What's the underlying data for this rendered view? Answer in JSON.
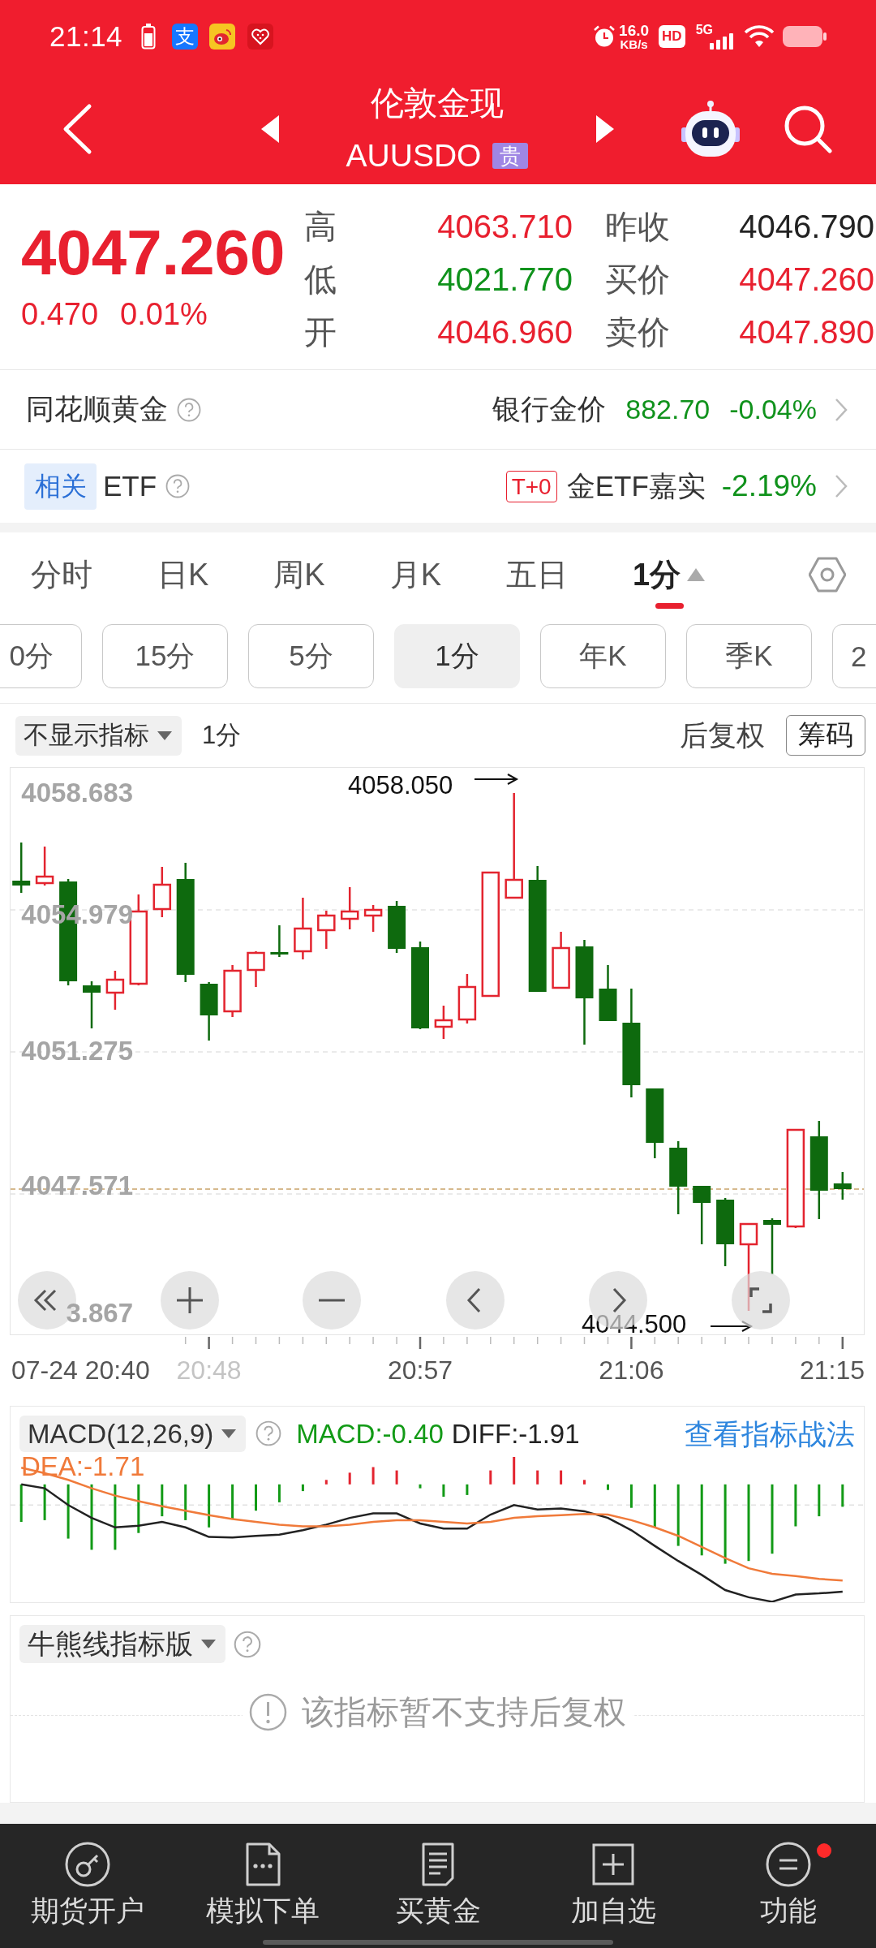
{
  "status_bar": {
    "time": "21:14",
    "app_badge": "支",
    "net_speed": "16.0",
    "net_unit": "KB/s",
    "hd_badge": "HD",
    "network": "5G"
  },
  "header": {
    "title": "伦敦金现",
    "code": "AUUSDO",
    "code_tag": "贵"
  },
  "quote": {
    "price": "4047.260",
    "change": "0.470",
    "change_pct": "0.01%",
    "rising": true,
    "stats": [
      {
        "label": "高",
        "value": "4063.710",
        "color": "#e8202f"
      },
      {
        "label": "昨收",
        "value": "4046.790",
        "color": "#222222"
      },
      {
        "label": "低",
        "value": "4021.770",
        "color": "#10921c"
      },
      {
        "label": "买价",
        "value": "4047.260",
        "color": "#e8202f"
      },
      {
        "label": "开",
        "value": "4046.960",
        "color": "#e8202f"
      },
      {
        "label": "卖价",
        "value": "4047.890",
        "color": "#e8202f"
      }
    ]
  },
  "gold_row": {
    "title": "同花顺黄金",
    "quote_label": "银行金价",
    "value": "882.70",
    "change": "-0.04%",
    "rising": false
  },
  "etf_row": {
    "tag": "相关",
    "title": "ETF",
    "badge": "T+0",
    "quote_label": "金ETF嘉实",
    "change": "-2.19%",
    "rising": false
  },
  "period_tabs": [
    {
      "label": "分时",
      "kind": "period",
      "selected": false
    },
    {
      "label": "日K",
      "kind": "period",
      "selected": false
    },
    {
      "label": "周K",
      "kind": "period",
      "selected": false
    },
    {
      "label": "月K",
      "kind": "period",
      "selected": false
    },
    {
      "label": "五日",
      "kind": "period",
      "selected": false
    },
    {
      "label": "1分",
      "kind": "menu",
      "selected": true
    }
  ],
  "interval_buttons": [
    {
      "label": "0分",
      "selected": false
    },
    {
      "label": "15分",
      "selected": false
    },
    {
      "label": "5分",
      "selected": false
    },
    {
      "label": "1分",
      "selected": true
    },
    {
      "label": "年K",
      "selected": false
    },
    {
      "label": "季K",
      "selected": false
    },
    {
      "label": "2",
      "selected": false
    }
  ],
  "chart_toolbar": {
    "indicator_menu": "不显示指标",
    "interval": "1分",
    "adjust": "后复权",
    "chips_button": "筹码"
  },
  "kline_chart": {
    "y_labels": [
      "4058.683",
      "4054.979",
      "4051.275",
      "4047.571",
      "3.867"
    ],
    "high_note": "4058.050",
    "low_note": "4044.500",
    "x_labels": [
      "07-24 20:40",
      "20:48",
      "20:57",
      "21:06",
      "21:15"
    ]
  },
  "macd_panel": {
    "menu": "MACD(12,26,9)",
    "macd": "MACD:-0.40",
    "diff": "DIFF:-1.91",
    "dea": "DEA:-1.71",
    "link": "查看指标战法"
  },
  "bull_bear_panel": {
    "menu": "牛熊线指标版",
    "message": "该指标暂不支持后复权"
  },
  "bottom_nav": [
    {
      "label": "期货开户",
      "kind": "account",
      "dot": false
    },
    {
      "label": "模拟下单",
      "kind": "simulate",
      "dot": false
    },
    {
      "label": "买黄金",
      "kind": "buy",
      "dot": false
    },
    {
      "label": "加自选",
      "kind": "add",
      "dot": false
    },
    {
      "label": "功能",
      "kind": "functions",
      "dot": true
    }
  ]
}
